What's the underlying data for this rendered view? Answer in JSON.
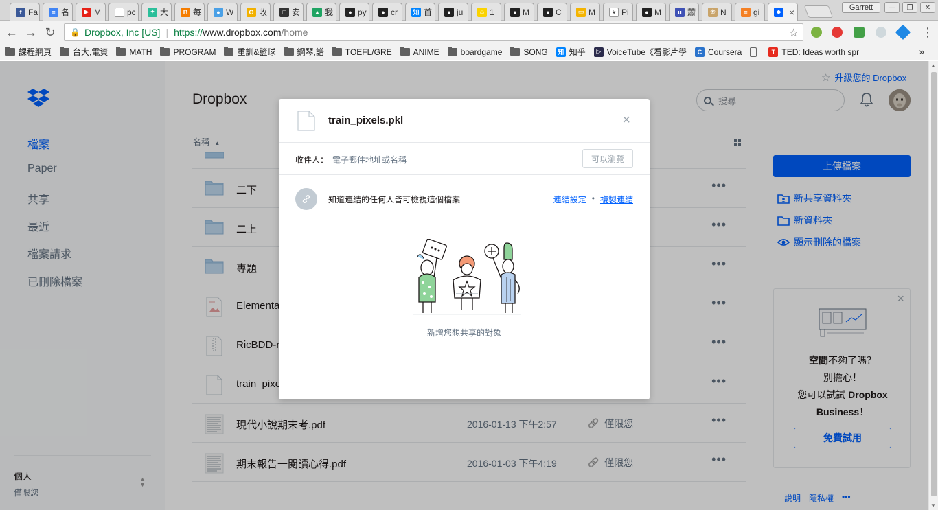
{
  "browser": {
    "tabs": [
      {
        "label": "Fa",
        "color": "#3b5998",
        "glyph": "f"
      },
      {
        "label": "名",
        "color": "#4285f4",
        "glyph": "≡"
      },
      {
        "label": "M",
        "color": "#e62117",
        "glyph": "▶"
      },
      {
        "label": "pc",
        "color": "#ffffff",
        "glyph": ""
      },
      {
        "label": "大",
        "color": "#2bbf9a",
        "glyph": "✦"
      },
      {
        "label": "每",
        "color": "#f57d00",
        "glyph": "B"
      },
      {
        "label": "W",
        "color": "#4aa0e6",
        "glyph": "●"
      },
      {
        "label": "收",
        "color": "#f2b100",
        "glyph": "O"
      },
      {
        "label": "安",
        "color": "#333333",
        "glyph": "□"
      },
      {
        "label": "我",
        "color": "#1fa463",
        "glyph": "▲"
      },
      {
        "label": "py",
        "color": "#222222",
        "glyph": "●"
      },
      {
        "label": "cr",
        "color": "#222222",
        "glyph": "●"
      },
      {
        "label": "首",
        "color": "#0084ff",
        "glyph": "知"
      },
      {
        "label": "ju",
        "color": "#222222",
        "glyph": "●"
      },
      {
        "label": "1",
        "color": "#fbd300",
        "glyph": "☺"
      },
      {
        "label": "M",
        "color": "#222222",
        "glyph": "●"
      },
      {
        "label": "C",
        "color": "#222222",
        "glyph": "●"
      },
      {
        "label": "M",
        "color": "#f4b400",
        "glyph": "▭"
      },
      {
        "label": "Pi",
        "color": "#ffffff",
        "glyph": "k"
      },
      {
        "label": "M",
        "color": "#222222",
        "glyph": "●"
      },
      {
        "label": "蕭",
        "color": "#3f51b5",
        "glyph": "u"
      },
      {
        "label": "N",
        "color": "#c9a46a",
        "glyph": "❀"
      },
      {
        "label": "gi",
        "color": "#f48024",
        "glyph": "≡"
      },
      {
        "label": "",
        "color": "#0061fe",
        "glyph": "◆",
        "active": true,
        "close": "×"
      }
    ],
    "profile_name": "Garrett",
    "window_controls": [
      "—",
      "❐",
      "✕"
    ],
    "address": {
      "ev_label": "Dropbox, Inc [US]",
      "separator": "|",
      "scheme": "https://",
      "host": "www.dropbox.com",
      "path": "/home"
    },
    "bookmarks": [
      {
        "label": "課程網頁",
        "type": "folder"
      },
      {
        "label": "台大,電資",
        "type": "folder"
      },
      {
        "label": "MATH",
        "type": "folder"
      },
      {
        "label": "PROGRAM",
        "type": "folder"
      },
      {
        "label": "重訓&籃球",
        "type": "folder"
      },
      {
        "label": "鋼琴,譜",
        "type": "folder"
      },
      {
        "label": "TOEFL/GRE",
        "type": "folder"
      },
      {
        "label": "ANIME",
        "type": "folder"
      },
      {
        "label": "boardgame",
        "type": "folder"
      },
      {
        "label": "SONG",
        "type": "folder"
      },
      {
        "label": "知乎",
        "type": "site",
        "color": "#0084ff",
        "glyph": "知"
      },
      {
        "label": "VoiceTube《看影片學",
        "type": "site",
        "color": "#2b2b4b",
        "glyph": "▷"
      },
      {
        "label": "Coursera",
        "type": "site",
        "color": "#2a73cc",
        "glyph": "C"
      },
      {
        "label": "",
        "type": "page"
      },
      {
        "label": "TED: Ideas worth spr",
        "type": "site",
        "color": "#e62b1e",
        "glyph": "T"
      }
    ],
    "bookmarks_more": "»"
  },
  "sidebar": {
    "nav": [
      "檔案",
      "Paper",
      "共享",
      "最近",
      "檔案請求",
      "已刪除檔案"
    ],
    "active_index": 0,
    "account_name": "個人",
    "account_sub": "僅限您"
  },
  "header": {
    "upgrade_label": "升級您的 Dropbox",
    "title": "Dropbox",
    "search_placeholder": "搜尋"
  },
  "files": {
    "sort_label": "名稱",
    "sort_arrow": "▲",
    "rows": [
      {
        "name": "二下",
        "kind": "folder",
        "date": "",
        "share": ""
      },
      {
        "name": "二上",
        "kind": "folder",
        "date": "",
        "share": ""
      },
      {
        "name": "專題",
        "kind": "folder",
        "date": "",
        "share": ""
      },
      {
        "name": "Elementa",
        "kind": "image",
        "date": "",
        "share": ""
      },
      {
        "name": "RicBDD-r",
        "kind": "archive",
        "date": "",
        "share": ""
      },
      {
        "name": "train_pixe",
        "kind": "file",
        "date": "",
        "share": ""
      },
      {
        "name": "現代小說期末考.pdf",
        "kind": "pdf",
        "date": "2016-01-13 下午2:57",
        "share": "僅限您"
      },
      {
        "name": "期末報告一閱讀心得.pdf",
        "kind": "pdf",
        "date": "2016-01-03 下午4:19",
        "share": "僅限您"
      }
    ],
    "more_glyph": "•••"
  },
  "actions": {
    "upload_label": "上傳檔案",
    "items": [
      "新共享資料夾",
      "新資料夾",
      "顯示刪除的檔案"
    ]
  },
  "promo": {
    "line1_bold": "空間",
    "line1_rest": "不夠了嗎？",
    "line2": "別擔心！",
    "line3_pre": "您可以試試 ",
    "line3_bold": "Dropbox",
    "line4_bold": "Business",
    "line4_rest": "！",
    "trial_label": "免費試用",
    "close": "×"
  },
  "footer": {
    "links": [
      "說明",
      "隱私權",
      "•••"
    ]
  },
  "share_modal": {
    "file_name": "train_pixels.pkl",
    "close": "×",
    "to_label": "收件人：",
    "to_placeholder": "電子郵件地址或名稱",
    "permission": "可以瀏覽",
    "link_text": "知道連結的任何人皆可檢視這個檔案",
    "link_settings": "連結設定",
    "link_dot": "•",
    "copy_link": "複製連結",
    "empty_state": "新增您想共享的對象"
  }
}
